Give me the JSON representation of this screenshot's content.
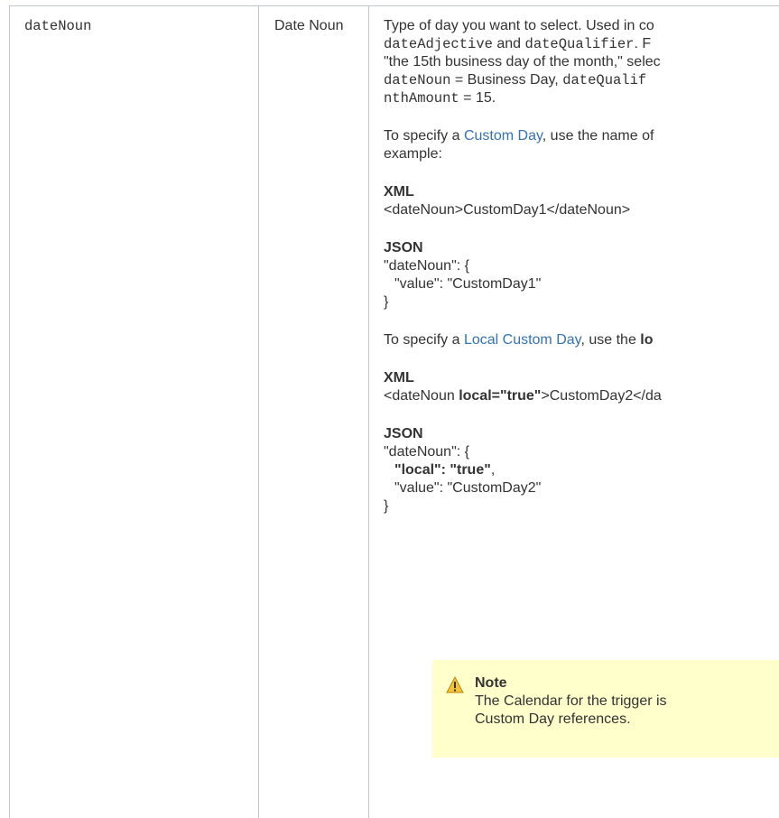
{
  "row": {
    "name": "dateNoun",
    "label": "Date Noun",
    "description": {
      "l1_a": "Type of day you want to select. Used in co",
      "l2_a": "dateAdjective",
      "l2_b": " and ",
      "l2_c": "dateQualifier",
      "l2_d": ". F",
      "l3": "\"the 15th business day of the month,\" selec",
      "l4_a": "dateNoun",
      "l4_b": " = Business Day, ",
      "l4_c": "dateQualif",
      "l5_a": "nthAmount",
      "l5_b": " = 15.",
      "p2_a": "To specify a ",
      "p2_link": "Custom Day",
      "p2_b": ", use the name of",
      "p2_l2": "example:",
      "xml1_heading": "XML",
      "xml1_code": "<dateNoun>CustomDay1</dateNoun>",
      "json1_heading": "JSON",
      "json1_l1": "\"dateNoun\": {",
      "json1_l2": "\"value\": \"CustomDay1\"",
      "json1_l3": "}",
      "p3_a": "To specify a ",
      "p3_link": "Local Custom Day",
      "p3_b": ", use the ",
      "p3_bold": "lo",
      "xml2_heading": "XML",
      "xml2_a": "<dateNoun ",
      "xml2_bold": "local=\"true\"",
      "xml2_b": ">CustomDay2</da",
      "json2_heading": "JSON",
      "json2_l1": "\"dateNoun\": {",
      "json2_l2_bold": "\"local\": \"true\"",
      "json2_l2_rest": ",",
      "json2_l3": "\"value\": \"CustomDay2\"",
      "json2_l4": "}"
    },
    "note": {
      "icon": "warning-icon",
      "title": "Note",
      "line1": "The Calendar for the trigger is",
      "line2": "Custom Day references."
    }
  },
  "colors": {
    "link": "#3572b0",
    "note_bg": "#ffffcc",
    "border": "#c1c7d0",
    "text": "#333333"
  }
}
